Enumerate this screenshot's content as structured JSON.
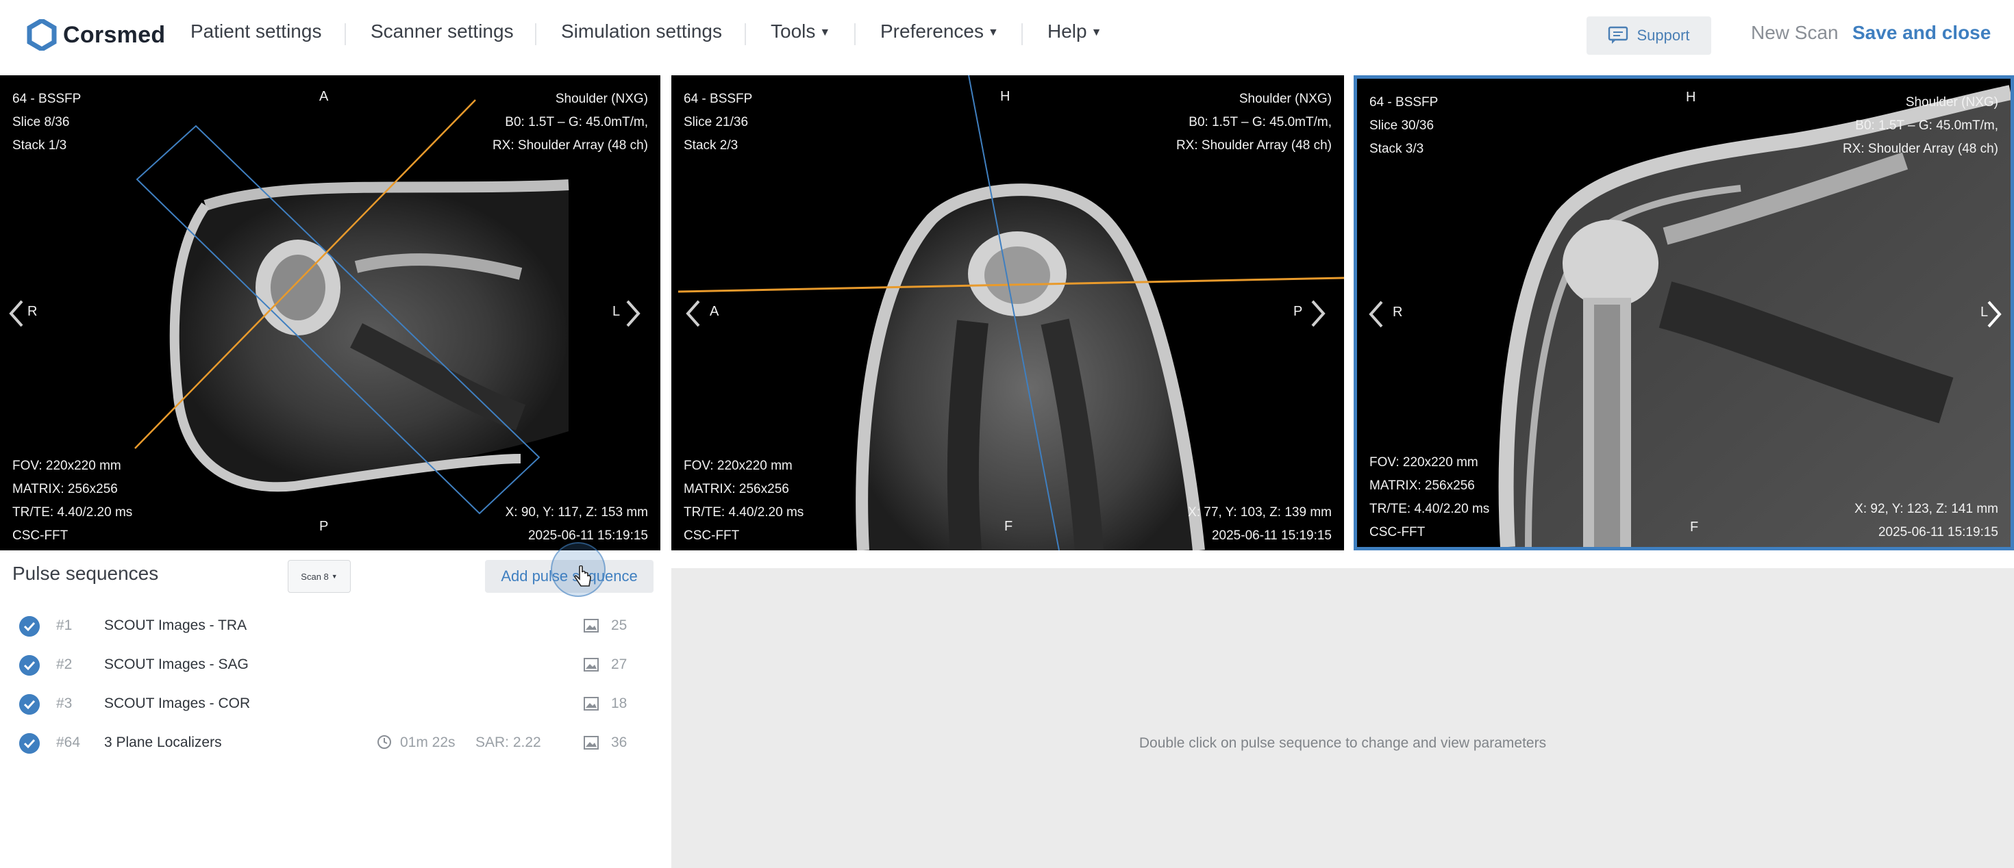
{
  "brand": {
    "name": "Corsmed"
  },
  "menu": {
    "patient_settings": "Patient settings",
    "scanner_settings": "Scanner settings",
    "simulation_settings": "Simulation settings",
    "tools": "Tools",
    "preferences": "Preferences",
    "help": "Help"
  },
  "header_actions": {
    "support": "Support",
    "new_scan": "New Scan",
    "save_and_close": "Save and close"
  },
  "viewers": [
    {
      "sequence": "64 - BSSFP",
      "slice": "Slice 8/36",
      "stack": "Stack 1/3",
      "region": "Shoulder (NXG)",
      "field": "B0: 1.5T – G: 45.0mT/m,",
      "coil": "RX: Shoulder Array (48 ch)",
      "top": "A",
      "bottom": "P",
      "left": "R",
      "right": "L",
      "fov": "FOV: 220x220 mm",
      "matrix": "MATRIX: 256x256",
      "trte": "TR/TE: 4.40/2.20 ms",
      "recon": "CSC-FFT",
      "coords": "X: 90, Y: 117, Z: 153 mm",
      "datetime": "2025-06-11 15:19:15"
    },
    {
      "sequence": "64 - BSSFP",
      "slice": "Slice 21/36",
      "stack": "Stack 2/3",
      "region": "Shoulder (NXG)",
      "field": "B0: 1.5T – G: 45.0mT/m,",
      "coil": "RX: Shoulder Array (48 ch)",
      "top": "H",
      "bottom": "F",
      "left": "A",
      "right": "P",
      "fov": "FOV: 220x220 mm",
      "matrix": "MATRIX: 256x256",
      "trte": "TR/TE: 4.40/2.20 ms",
      "recon": "CSC-FFT",
      "coords": "X: 77, Y: 103, Z: 139 mm",
      "datetime": "2025-06-11 15:19:15"
    },
    {
      "sequence": "64 - BSSFP",
      "slice": "Slice 30/36",
      "stack": "Stack 3/3",
      "region": "Shoulder (NXG)",
      "field": "B0: 1.5T – G: 45.0mT/m,",
      "coil": "RX: Shoulder Array (48 ch)",
      "top": "H",
      "bottom": "F",
      "left": "R",
      "right": "L",
      "fov": "FOV: 220x220 mm",
      "matrix": "MATRIX: 256x256",
      "trte": "TR/TE: 4.40/2.20 ms",
      "recon": "CSC-FFT",
      "coords": "X: 92, Y: 123, Z: 141 mm",
      "datetime": "2025-06-11 15:19:15"
    }
  ],
  "pulse_sequences": {
    "title": "Pulse sequences",
    "scan_selector": "Scan 8",
    "add_button": "Add pulse sequence",
    "items": [
      {
        "number": "#1",
        "name": "SCOUT Images - TRA",
        "duration": "",
        "sar": "",
        "images": "25",
        "checked": true
      },
      {
        "number": "#2",
        "name": "SCOUT Images - SAG",
        "duration": "",
        "sar": "",
        "images": "27",
        "checked": true
      },
      {
        "number": "#3",
        "name": "SCOUT Images - COR",
        "duration": "",
        "sar": "",
        "images": "18",
        "checked": true
      },
      {
        "number": "#64",
        "name": "3 Plane Localizers",
        "duration": "01m 22s",
        "sar": "SAR: 2.22",
        "images": "36",
        "checked": true
      }
    ]
  },
  "parameters_panel": {
    "hint": "Double click on pulse sequence to change and view parameters"
  },
  "colors": {
    "accent": "#3f7fc0",
    "slice_line_orange": "#e89a2c",
    "slice_line_blue": "#3f7fc0",
    "params_bg": "#ebebeb"
  },
  "icons": [
    "corsmed-logo-icon",
    "chat-icon",
    "caret-down-icon",
    "chevron-left-icon",
    "chevron-right-icon",
    "check-icon",
    "clock-icon",
    "image-icon",
    "cursor-icon"
  ]
}
